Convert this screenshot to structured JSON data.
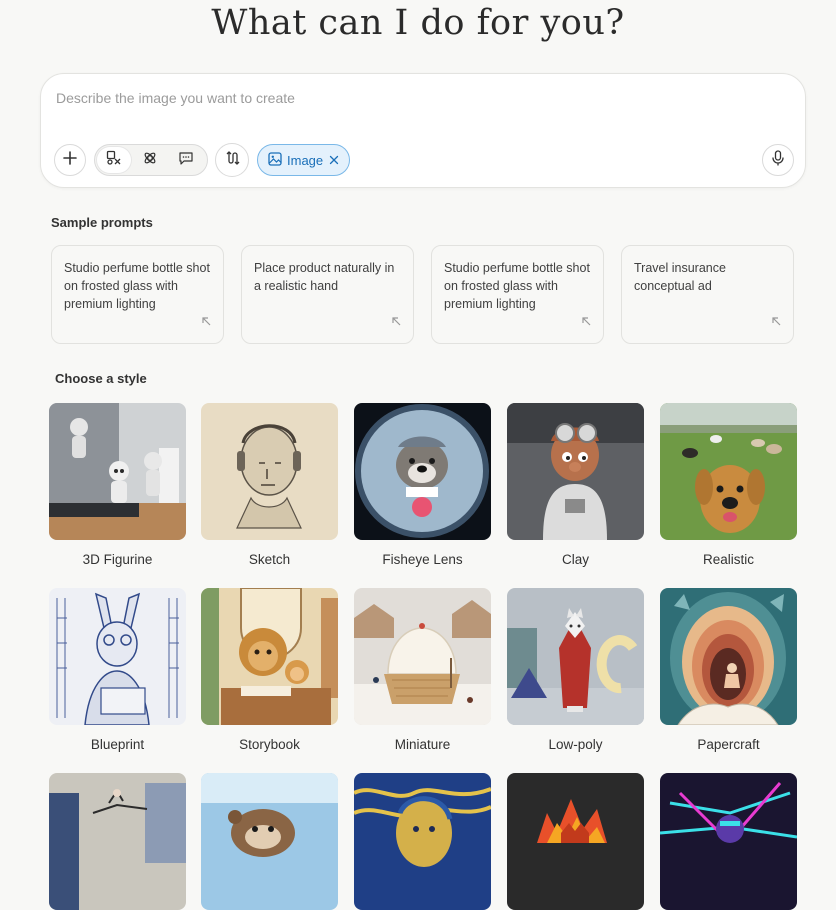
{
  "heading": "What can I do for you?",
  "composer": {
    "placeholder": "Describe the image you want to create",
    "chip_label": "Image",
    "icons": [
      "plus-icon",
      "image-mode-icon",
      "sparkle-icon",
      "chat-icon",
      "swap-icon",
      "image-icon",
      "close-icon",
      "microphone-icon"
    ]
  },
  "sample_prompts": {
    "label": "Sample prompts",
    "items": [
      "Studio perfume bottle shot on frosted glass with premium lighting",
      "Place product naturally in a realistic hand",
      "Studio perfume bottle shot on frosted glass with premium lighting",
      "Travel insurance conceptual ad"
    ]
  },
  "styles": {
    "label": "Choose a style",
    "items": [
      "3D Figurine",
      "Sketch",
      "Fisheye Lens",
      "Clay",
      "Realistic",
      "Blueprint",
      "Storybook",
      "Miniature",
      "Low-poly",
      "Papercraft"
    ]
  },
  "colors": {
    "accent": "#1a6fb8",
    "chip_bg": "#e4f1fc",
    "page_bg": "#f8f8f6"
  }
}
